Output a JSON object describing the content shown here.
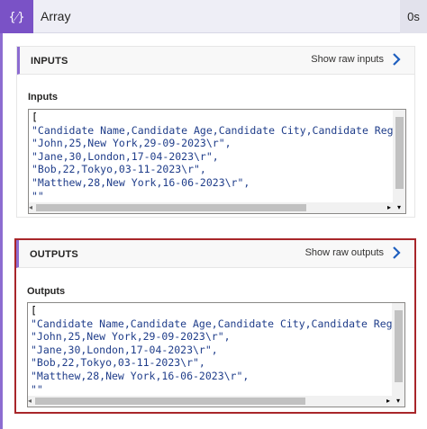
{
  "header": {
    "icon_glyph": "{⁄}",
    "title": "Array",
    "duration": "0s"
  },
  "inputs_panel": {
    "label": "INPUTS",
    "raw_button": "Show raw inputs",
    "section_label": "Inputs",
    "code": {
      "open_bracket": "[",
      "lines": [
        "\"Candidate Name,Candidate Age,Candidate City,Candidate Registerat",
        "\"John,25,New York,29-09-2023\\r\",",
        "\"Jane,30,London,17-04-2023\\r\",",
        "\"Bob,22,Tokyo,03-11-2023\\r\",",
        "\"Matthew,28,New York,16-06-2023\\r\",",
        "\"\""
      ]
    }
  },
  "outputs_panel": {
    "label": "OUTPUTS",
    "raw_button": "Show raw outputs",
    "section_label": "Outputs",
    "code": {
      "open_bracket": "[",
      "lines": [
        "\"Candidate Name,Candidate Age,Candidate City,Candidate Registerat",
        "\"John,25,New York,29-09-2023\\r\",",
        "\"Jane,30,London,17-04-2023\\r\",",
        "\"Bob,22,Tokyo,03-11-2023\\r\",",
        "\"Matthew,28,New York,16-06-2023\\r\",",
        "\"\""
      ]
    }
  },
  "colors": {
    "accent": "#7a52c6",
    "highlight_border": "#a8262a",
    "link_chevron": "#1f5fbf"
  }
}
